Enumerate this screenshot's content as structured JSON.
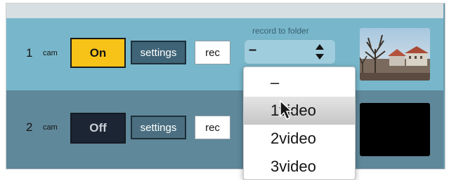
{
  "folder_label": "record to folder",
  "folder_select": {
    "value": "–"
  },
  "cams": [
    {
      "number": "1",
      "word": "cam",
      "toggle": "On",
      "settings": "settings",
      "rec": "rec"
    },
    {
      "number": "2",
      "word": "cam",
      "toggle": "Off",
      "settings": "settings",
      "rec": "rec"
    }
  ],
  "dropdown": {
    "options": [
      "–",
      "1video",
      "2video",
      "3video"
    ],
    "highlighted": "1video"
  },
  "colors": {
    "row1_bg": "#78b7cb",
    "row2_bg": "#5f889a",
    "on_yellow": "#f7c318",
    "off_dark": "#1c2533"
  },
  "icons": [
    "select-arrows-icon",
    "mouse-pointer-icon"
  ]
}
